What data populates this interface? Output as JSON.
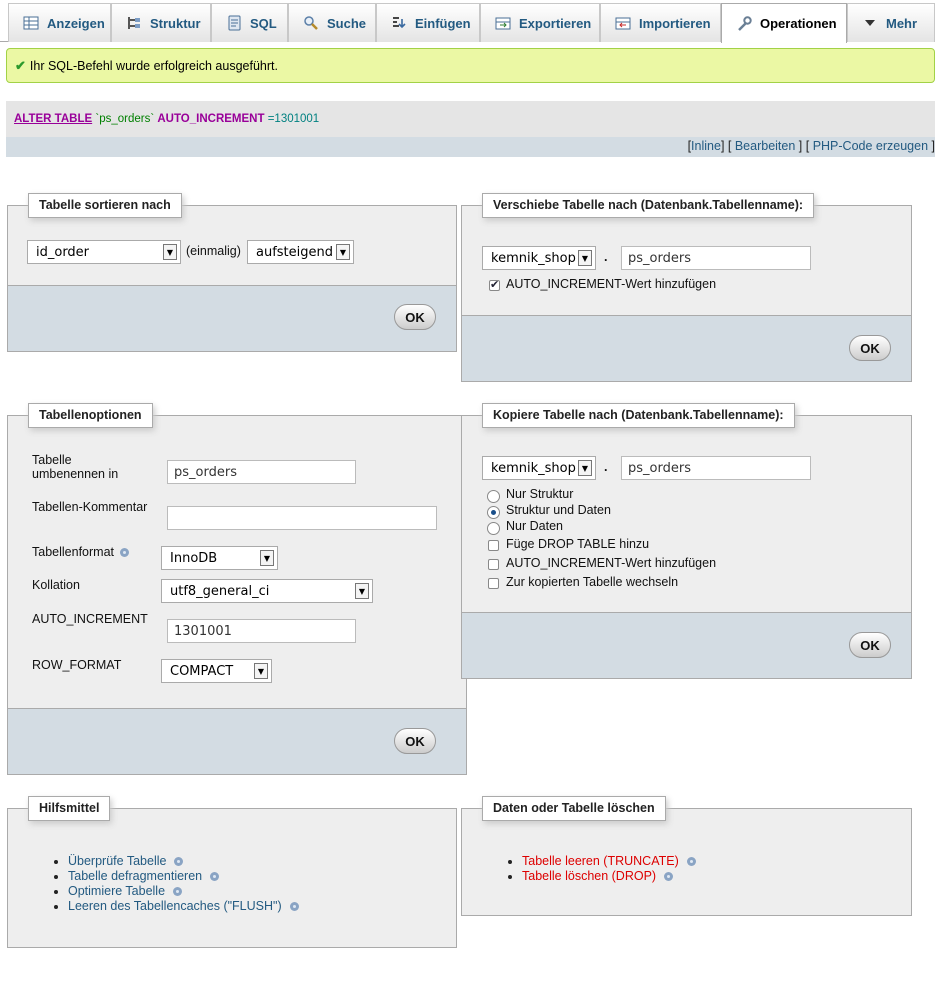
{
  "tabs": [
    {
      "label": "Anzeigen",
      "icon": "table-browse-icon"
    },
    {
      "label": "Struktur",
      "icon": "structure-icon"
    },
    {
      "label": "SQL",
      "icon": "sql-icon"
    },
    {
      "label": "Suche",
      "icon": "search-icon"
    },
    {
      "label": "Einfügen",
      "icon": "insert-icon"
    },
    {
      "label": "Exportieren",
      "icon": "export-icon"
    },
    {
      "label": "Importieren",
      "icon": "import-icon"
    },
    {
      "label": "Operationen",
      "icon": "wrench-icon",
      "active": true
    },
    {
      "label": "Mehr",
      "icon": "triangle-down-icon"
    }
  ],
  "message": {
    "text": "Ihr SQL-Befehl wurde erfolgreich ausgeführt."
  },
  "sql": {
    "kw1": "ALTER TABLE",
    "table": "`ps_orders`",
    "kw2": "AUTO_INCREMENT",
    "value": "=1301001",
    "links": {
      "inline": "Inline",
      "edit": "Bearbeiten",
      "php": "PHP-Code erzeugen"
    }
  },
  "sort": {
    "legend": "Tabelle sortieren nach",
    "column": "id_order",
    "once": "(einmalig)",
    "order": "aufsteigend",
    "ok": "OK"
  },
  "move": {
    "legend": "Verschiebe Tabelle nach (Datenbank.Tabellenname):",
    "db": "kemnik_shop",
    "dot": ".",
    "table": "ps_orders",
    "auto_inc_label": "AUTO_INCREMENT-Wert hinzufügen",
    "ok": "OK"
  },
  "options": {
    "legend": "Tabellenoptionen",
    "rename_label": "Tabelle umbenennen in",
    "rename_value": "ps_orders",
    "comment_label": "Tabellen-Kommentar",
    "comment_value": "",
    "format_label": "Tabellenformat",
    "format_value": "InnoDB",
    "collation_label": "Kollation",
    "collation_value": "utf8_general_ci",
    "autoinc_label": "AUTO_INCREMENT",
    "autoinc_value": "1301001",
    "rowformat_label": "ROW_FORMAT",
    "rowformat_value": "COMPACT",
    "ok": "OK"
  },
  "copy": {
    "legend": "Kopiere Tabelle nach (Datenbank.Tabellenname):",
    "db": "kemnik_shop",
    "dot": ".",
    "table": "ps_orders",
    "opt_structure": "Nur Struktur",
    "opt_structure_data": "Struktur und Daten",
    "opt_data": "Nur Daten",
    "drop_table": "Füge DROP TABLE hinzu",
    "auto_inc": "AUTO_INCREMENT-Wert hinzufügen",
    "switch": "Zur kopierten Tabelle wechseln",
    "ok": "OK"
  },
  "tools": {
    "legend": "Hilfsmittel",
    "items": [
      "Überprüfe Tabelle",
      "Tabelle defragmentieren",
      "Optimiere Tabelle",
      "Leeren des Tabellencaches (\"FLUSH\")"
    ]
  },
  "delete": {
    "legend": "Daten oder Tabelle löschen",
    "items": [
      "Tabelle leeren (TRUNCATE)",
      "Tabelle löschen (DROP)"
    ]
  },
  "colors": {
    "link": "#235a81",
    "danger": "#dd0000",
    "success_bg": "#ebf8a4",
    "footer": "#d3dce3"
  }
}
